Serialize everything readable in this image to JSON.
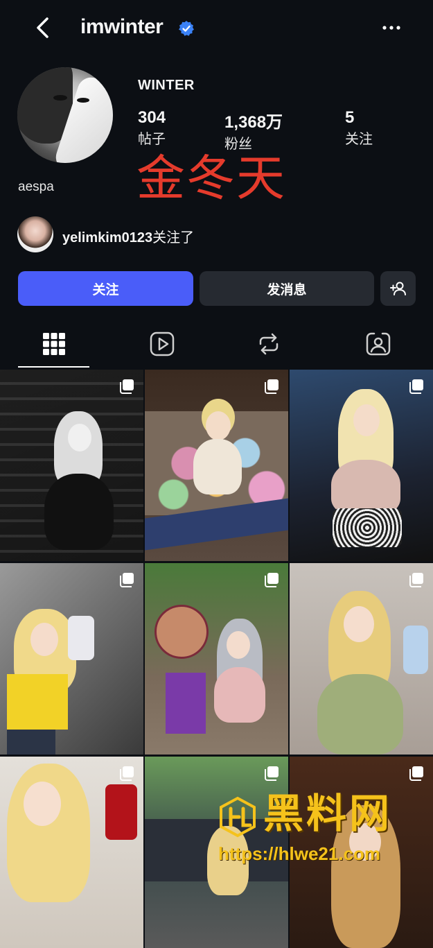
{
  "header": {
    "username": "imwinter"
  },
  "profile": {
    "display_name": "WINTER",
    "bio": "aespa",
    "stats": [
      {
        "value": "304",
        "label": "帖子"
      },
      {
        "value": "1,368万",
        "label": "粉丝"
      },
      {
        "value": "5",
        "label": "关注"
      }
    ],
    "overlay_text": "金冬天",
    "followed_by": {
      "user": "yelimkim0123",
      "suffix": "关注了"
    }
  },
  "actions": {
    "follow": "关注",
    "message": "发消息"
  },
  "tabs": [
    {
      "icon": "grid-icon",
      "active": true
    },
    {
      "icon": "reels-play-icon",
      "active": false
    },
    {
      "icon": "repost-icon",
      "active": false
    },
    {
      "icon": "tagged-person-icon",
      "active": false
    }
  ],
  "posts_count_visible": 9,
  "watermark": {
    "title": "黑料网",
    "url": "https://hlwe21.com"
  },
  "colors": {
    "accent": "#4a5df9",
    "verified": "#3b82f6",
    "overlay": "#e53b2c",
    "watermark": "#f5c21b"
  }
}
